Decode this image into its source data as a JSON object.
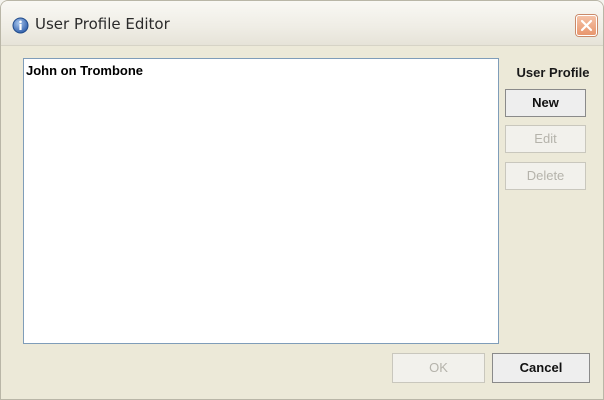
{
  "window": {
    "title": "User Profile Editor",
    "icons": {
      "app": "info-icon",
      "close": "close-icon"
    }
  },
  "profiles": {
    "items": [
      "John on Trombone"
    ]
  },
  "sidebar": {
    "heading": "User Profile",
    "new_label": "New",
    "edit_label": "Edit",
    "delete_label": "Delete"
  },
  "footer": {
    "ok_label": "OK",
    "cancel_label": "Cancel"
  },
  "colors": {
    "window_bg": "#ece9d8",
    "list_border": "#7f9db9",
    "disabled_text": "#b5b3ab"
  }
}
